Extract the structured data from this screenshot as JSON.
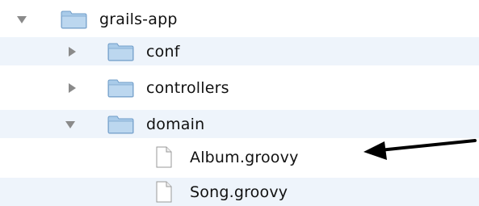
{
  "tree": {
    "root": {
      "label": "grails-app",
      "expanded": true
    },
    "children": [
      {
        "label": "conf",
        "expanded": false
      },
      {
        "label": "controllers",
        "expanded": false
      },
      {
        "label": "domain",
        "expanded": true
      }
    ],
    "domain_files": [
      {
        "label": "Album.groovy"
      },
      {
        "label": "Song.groovy"
      }
    ]
  },
  "colors": {
    "row_stripe": "#eef4fb",
    "folder_blue": "#9cc1e4",
    "disclosure_gray": "#8a8a8a",
    "arrow": "#000000"
  },
  "icons": {
    "folder": "folder-icon",
    "file": "file-icon",
    "expanded": "triangle-down-icon",
    "collapsed": "triangle-right-icon",
    "pointer": "arrow-left-icon"
  }
}
